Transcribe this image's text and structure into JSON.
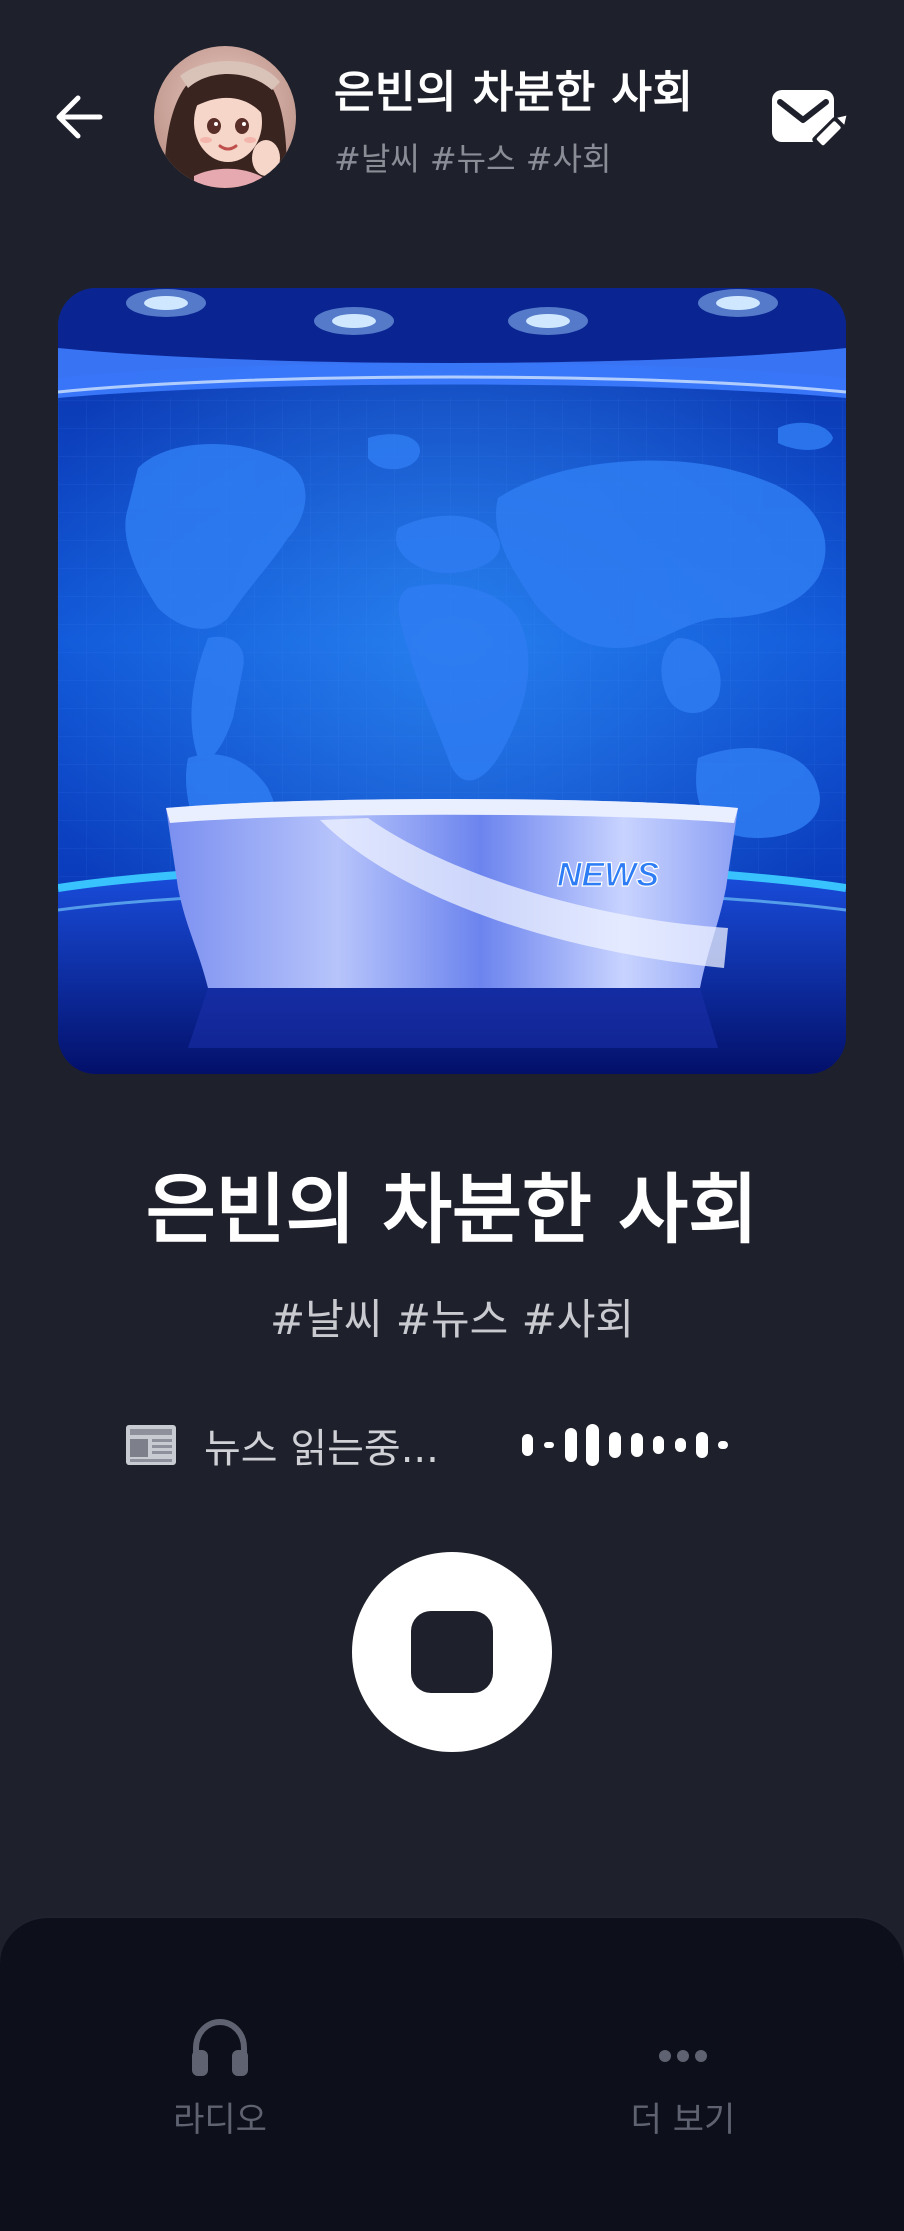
{
  "header": {
    "title": "은빈의 차분한 사회",
    "tags": "#날씨 #뉴스 #사회",
    "back_icon": "arrow-left-icon",
    "mail_icon": "mail-edit-icon"
  },
  "cover": {
    "desk_label": "NEWS"
  },
  "program": {
    "title": "은빈의 차분한 사회",
    "tags": "#날씨 #뉴스 #사회"
  },
  "status": {
    "icon": "newspaper-icon",
    "text": "뉴스 읽는중..."
  },
  "controls": {
    "stop_icon": "stop-icon"
  },
  "nav": {
    "items": [
      {
        "label": "라디오",
        "icon": "headphones-icon"
      },
      {
        "label": "더 보기",
        "icon": "more-dots-icon"
      }
    ]
  },
  "colors": {
    "background": "#1e202b",
    "nav_background": "#0d0f1a",
    "muted_text": "#8a8c96",
    "accent_blue": "#1e63e0"
  }
}
